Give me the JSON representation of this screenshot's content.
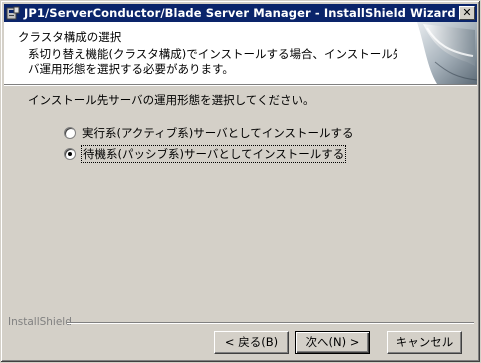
{
  "window": {
    "title": "JP1/ServerConductor/Blade Server Manager - InstallShield Wizard",
    "close_glyph": "✕"
  },
  "header": {
    "title": "クラスタ構成の選択",
    "desc_line1": "系切り替え機能(クラスタ構成)でインストールする場合、インストール先のサー",
    "desc_line2": "バ運用形態を選択する必要があります。"
  },
  "main": {
    "prompt": "インストール先サーバの運用形態を選択してください。",
    "options": [
      {
        "label": "実行系(アクティブ系)サーバとしてインストールする",
        "selected": false
      },
      {
        "label": "待機系(パッシブ系)サーバとしてインストールする",
        "selected": true
      }
    ]
  },
  "footer": {
    "brand": "InstallShield",
    "back_label": "< 戻る(B)",
    "next_label": "次へ(N) >",
    "cancel_label": "キャンセル"
  },
  "colors": {
    "titlebar": "#0a246a",
    "face": "#d4d0c8"
  }
}
